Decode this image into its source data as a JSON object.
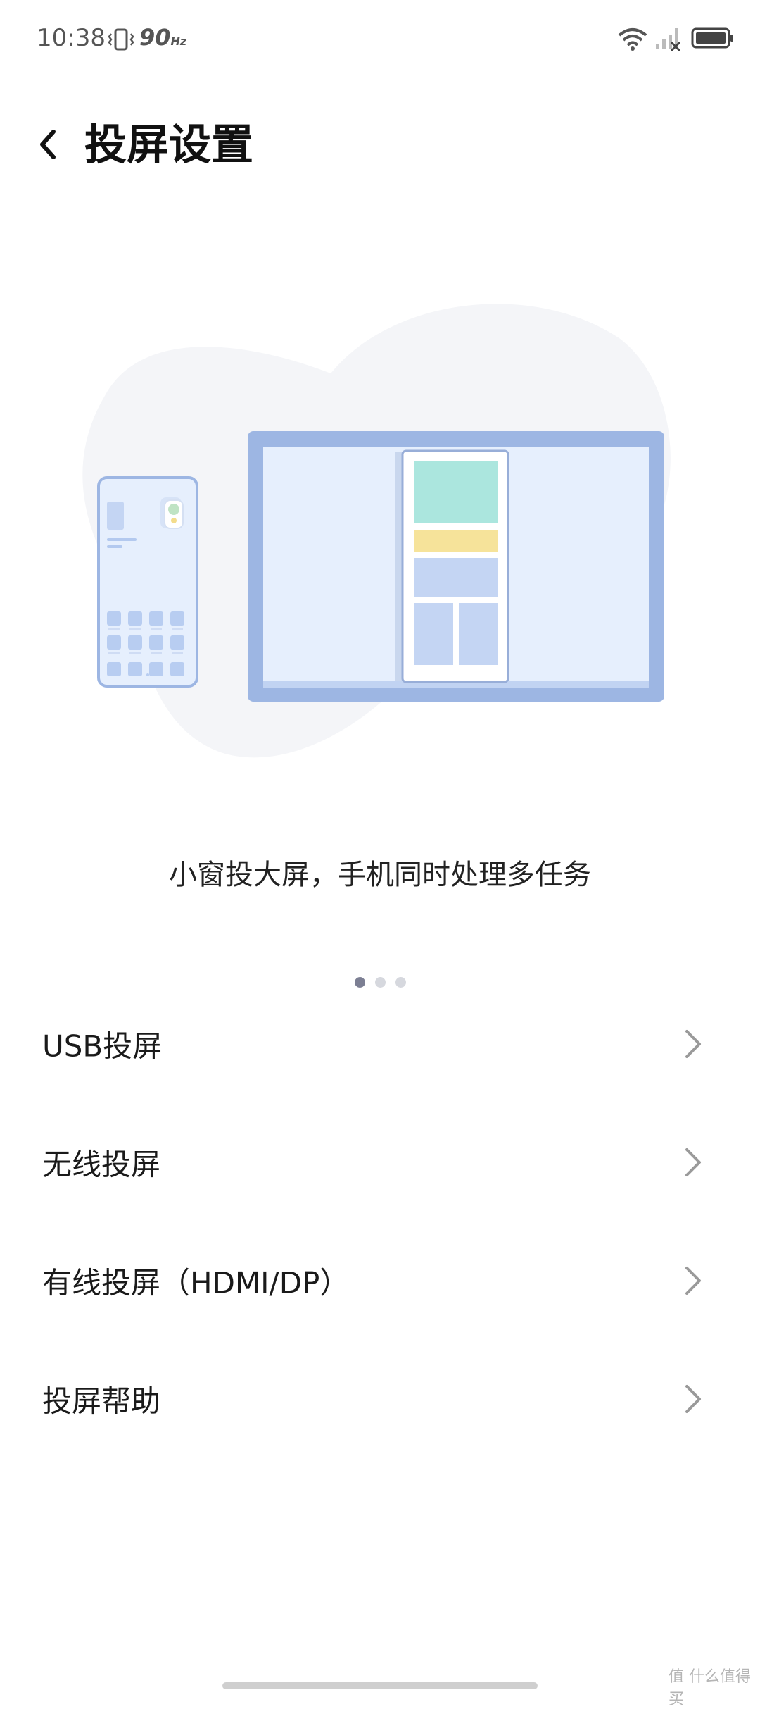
{
  "status_bar": {
    "time": "10:38",
    "refresh_rate": "90",
    "refresh_unit": "Hz",
    "icons": [
      "vibrate-icon",
      "wifi-icon",
      "signal-icon",
      "battery-icon"
    ]
  },
  "header": {
    "title": "投屏设置",
    "back_icon": "chevron-left-icon"
  },
  "carousel": {
    "caption": "小窗投大屏，手机同时处理多任务",
    "page_count": 3,
    "current_page": 1
  },
  "menu": {
    "items": [
      {
        "label": "USB投屏",
        "icon": "chevron-right-icon"
      },
      {
        "label": "无线投屏",
        "icon": "chevron-right-icon"
      },
      {
        "label": "有线投屏（HDMI/DP）",
        "icon": "chevron-right-icon"
      },
      {
        "label": "投屏帮助",
        "icon": "chevron-right-icon"
      }
    ]
  },
  "watermark": "值 什么值得买",
  "colors": {
    "accent": "#7c7f93",
    "illustration_frame": "#9db6e3",
    "illustration_fill": "#e6effd",
    "blob": "#f4f5f8"
  }
}
